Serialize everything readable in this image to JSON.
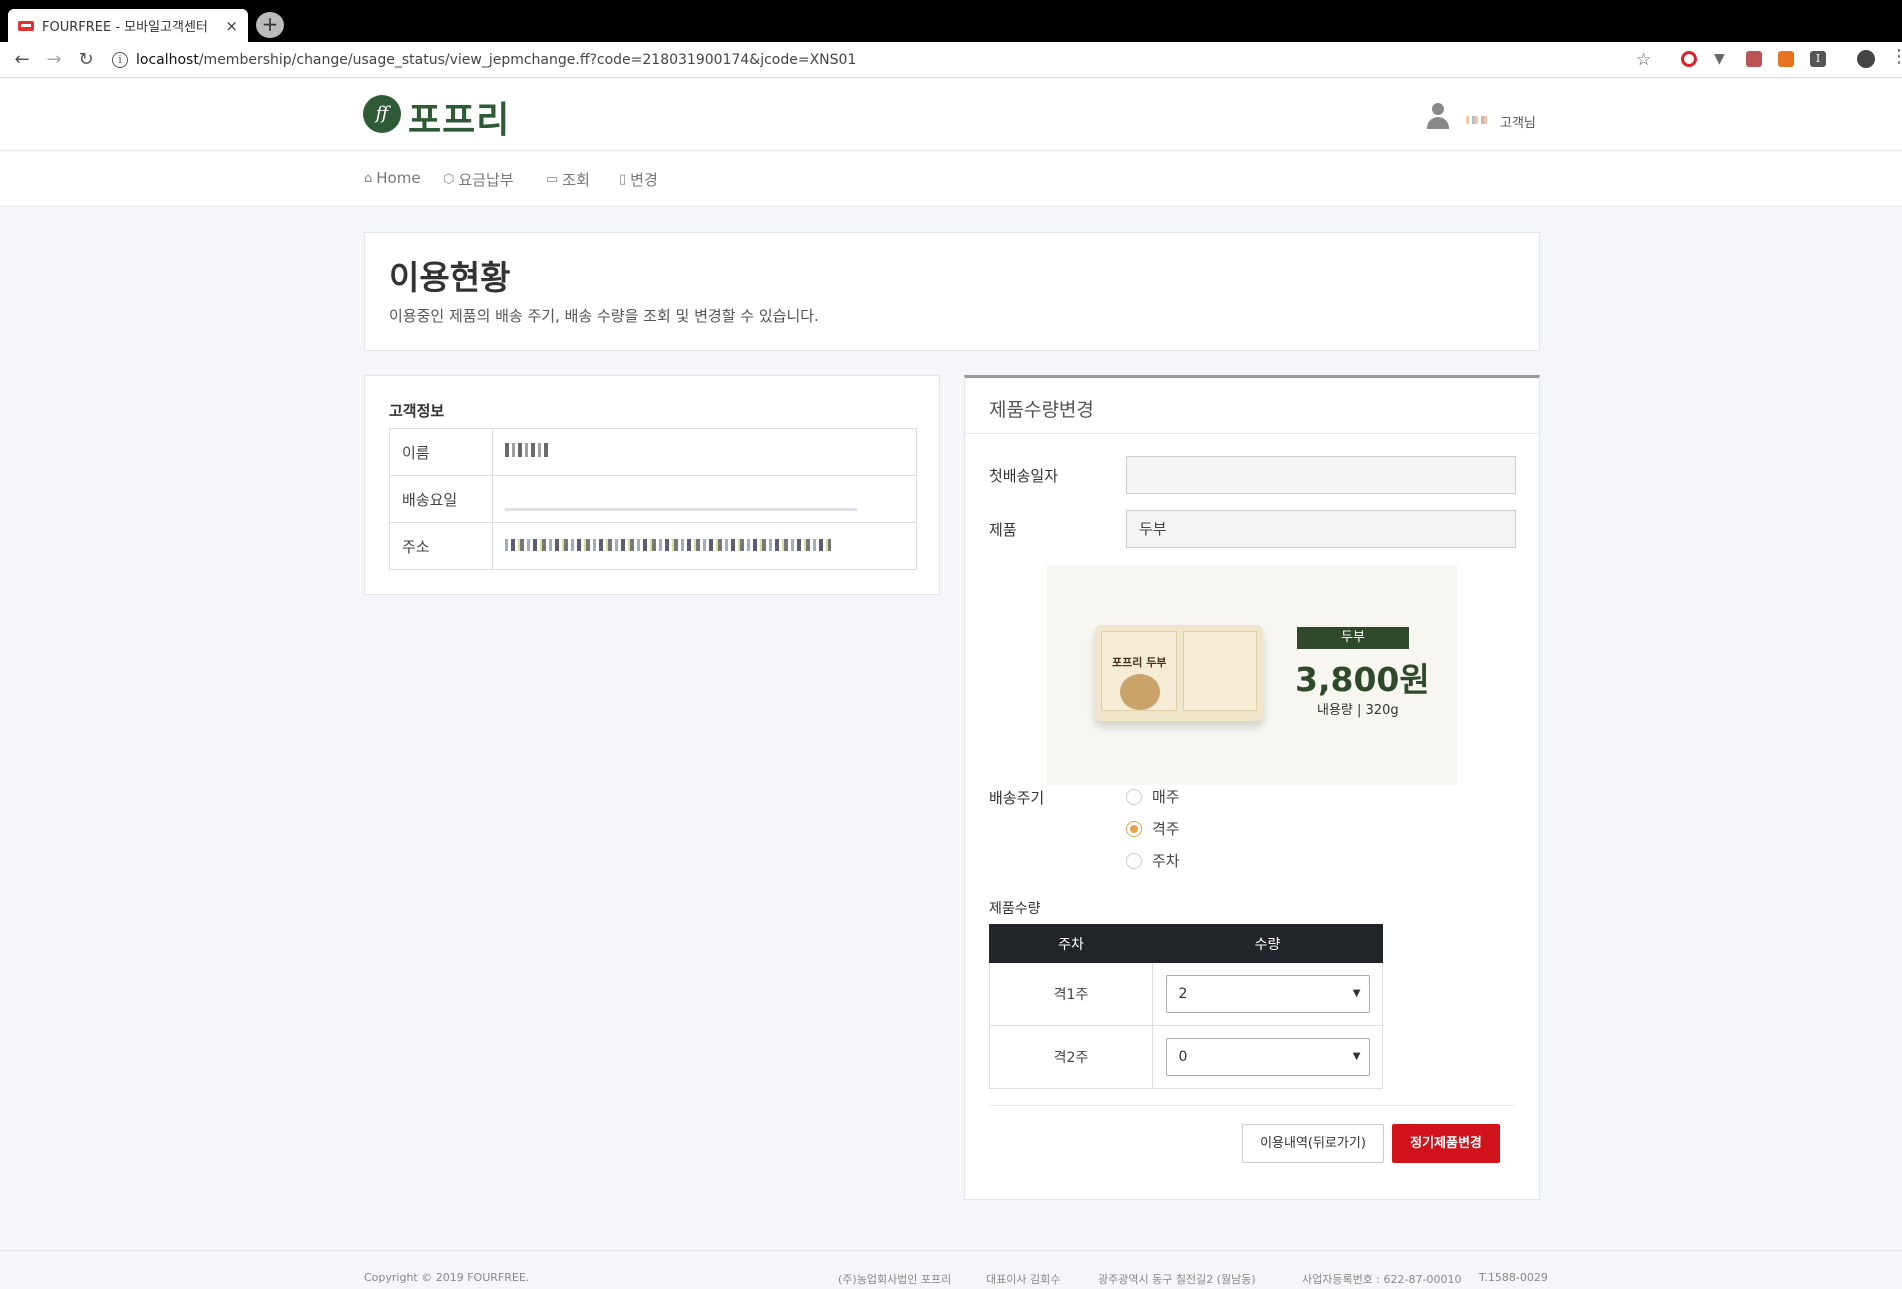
{
  "browser": {
    "tab_title": "FOURFREE - 모바일고객센터",
    "tab_close": "×",
    "new_tab": "+",
    "url_host": "localhost",
    "url_path": "/membership/change/usage_status/view_jepmchange.ff?code=218031900174&jcode=XNS01"
  },
  "header": {
    "logo_mark": "ff",
    "logo_text": "포프리",
    "user_suffix": "고객님"
  },
  "nav": {
    "items": [
      {
        "label": "Home",
        "icon": "home-icon"
      },
      {
        "label": "요금납부",
        "icon": "box-icon"
      },
      {
        "label": "조회",
        "icon": "calendar-icon"
      },
      {
        "label": "변경",
        "icon": "document-icon"
      }
    ]
  },
  "page": {
    "title": "이용현황",
    "description": "이용중인 제품의 배송 주기, 배송 수량을 조회 및 변경할 수 있습니다."
  },
  "customer": {
    "heading": "고객정보",
    "rows": [
      {
        "label": "이름"
      },
      {
        "label": "배송요일"
      },
      {
        "label": "주소"
      }
    ]
  },
  "change": {
    "title": "제품수량변경",
    "first_delivery_label": "첫배송일자",
    "first_delivery_value": "",
    "product_label": "제품",
    "product_value": "두부",
    "product_image": {
      "package_name": "포프리 두부",
      "badge": "두부",
      "price": "3,800원",
      "capacity": "내용량 | 320g"
    },
    "cycle_label": "배송주기",
    "cycle_options": [
      {
        "label": "매주",
        "checked": false
      },
      {
        "label": "격주",
        "checked": true
      },
      {
        "label": "주차",
        "checked": false
      }
    ],
    "qty_label": "제품수량",
    "qty_table": {
      "headers": [
        "주차",
        "수량"
      ],
      "rows": [
        {
          "week": "격1주",
          "qty": "2"
        },
        {
          "week": "격2주",
          "qty": "0"
        }
      ]
    },
    "back_button": "이용내역(뒤로가기)",
    "submit_button": "정기제품변경"
  },
  "footer": {
    "copyright": "Copyright © 2019 FOURFREE.",
    "company": "(주)농업회사법인 포프리",
    "ceo": "대표이사 김회수",
    "address": "광주광역시 동구 칠전길2 (월남동)",
    "biz_no": "사업자등록번호 : 622-87-00010",
    "tel": "T.1588-0029"
  },
  "colors": {
    "brand_green": "#2f5a36",
    "submit_red": "#d0121b",
    "radio_orange": "#e8a04c",
    "table_header": "#212429"
  }
}
